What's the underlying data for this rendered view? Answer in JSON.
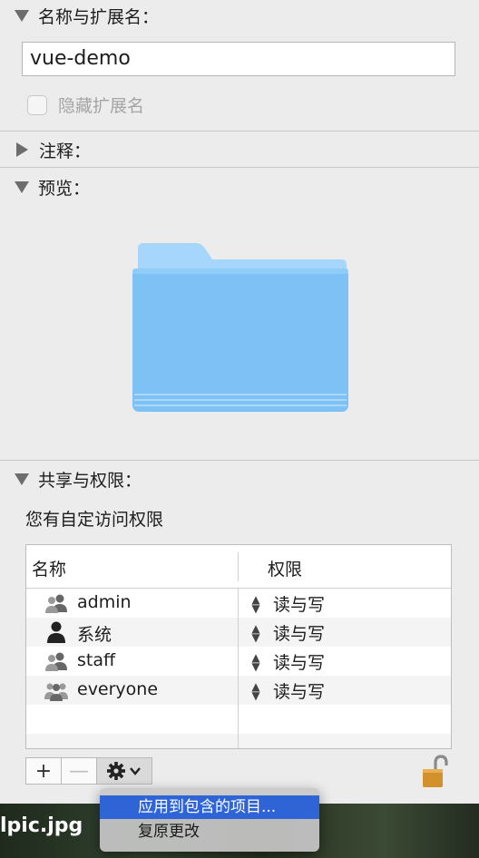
{
  "sections": {
    "name_ext": "名称与扩展名：",
    "comments": "注释：",
    "preview": "预览：",
    "sharing": "共享与权限："
  },
  "name_field": {
    "value": "vue-demo"
  },
  "hide_extension": {
    "label": "隐藏扩展名",
    "checked": false
  },
  "permission_note": "您有自定访问权限",
  "table": {
    "headers": {
      "name": "名称",
      "privilege": "权限"
    },
    "rows": [
      {
        "name": "admin",
        "privilege": "读与写",
        "icon": "group-icon"
      },
      {
        "name": "系统",
        "privilege": "读与写",
        "icon": "user-icon"
      },
      {
        "name": "staff",
        "privilege": "读与写",
        "icon": "group-icon"
      },
      {
        "name": "everyone",
        "privilege": "读与写",
        "icon": "everyone-icon"
      }
    ]
  },
  "toolbar": {
    "add": "+",
    "remove": "—"
  },
  "context_menu": {
    "items": [
      {
        "label": "应用到包含的项目...",
        "selected": true
      },
      {
        "label": "复原更改",
        "selected": false
      }
    ]
  },
  "background": {
    "filename": "lpic.jpg"
  },
  "colors": {
    "accent": "#2f64d6",
    "folder": "#7ec2f5"
  }
}
